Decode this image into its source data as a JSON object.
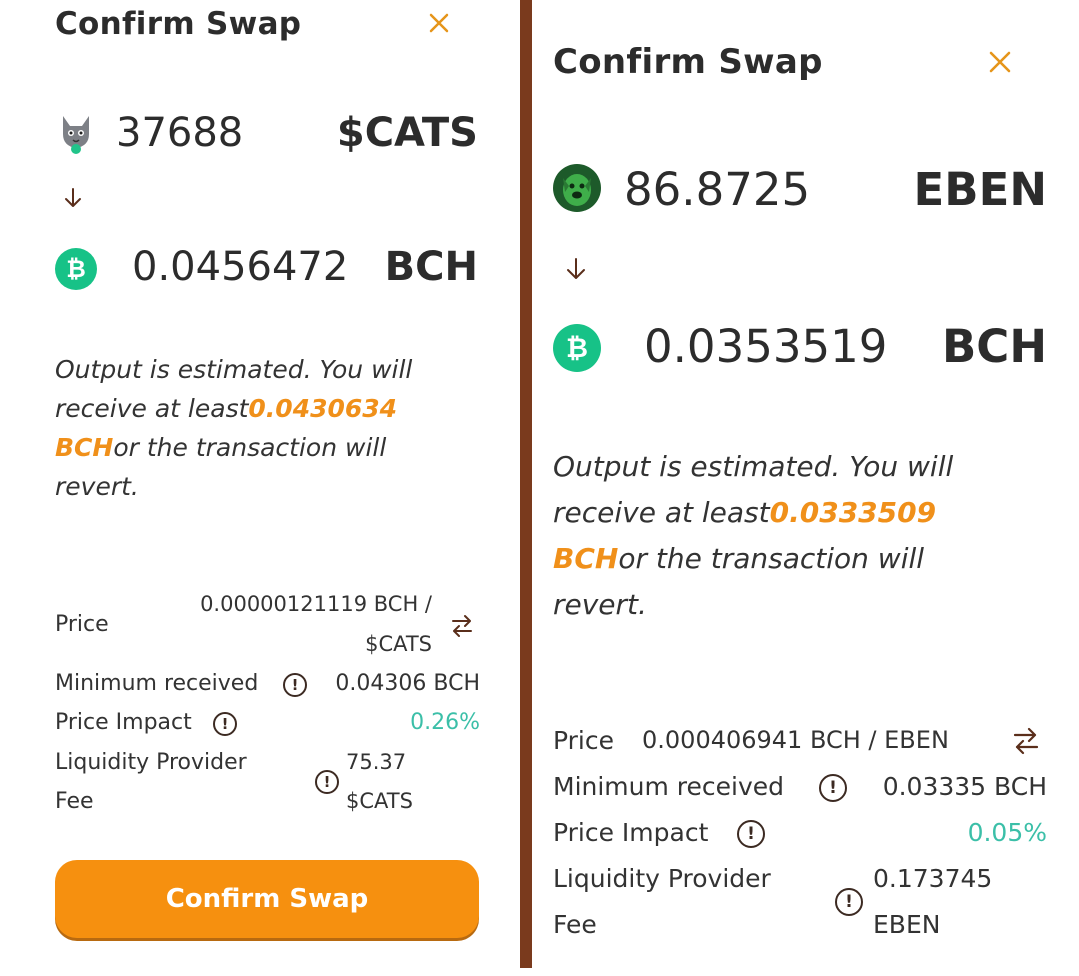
{
  "left": {
    "title": "Confirm Swap",
    "from": {
      "amount": "37688",
      "symbol": "$CATS",
      "icon": "cat-token-icon"
    },
    "to": {
      "amount": "0.0456472",
      "symbol": "BCH",
      "icon": "bch-icon"
    },
    "note": {
      "prefix": "Output is estimated. You will receive at least",
      "amount": "0.0430634",
      "unit": "BCH",
      "suffix": "or the transaction will revert."
    },
    "price_label": "Price",
    "price_value_line1": "0.00000121119 BCH /",
    "price_value_line2": "$CATS",
    "min_received_label": "Minimum received",
    "min_received_value": "0.04306 BCH",
    "impact_label": "Price Impact",
    "impact_value": "0.26%",
    "fee_label_line1": "Liquidity Provider",
    "fee_label_line2": "Fee",
    "fee_value_line1": "75.37",
    "fee_value_line2": "$CATS",
    "confirm_button": "Confirm Swap"
  },
  "right": {
    "title": "Confirm Swap",
    "from": {
      "amount": "86.8725",
      "symbol": "EBEN",
      "icon": "eben-token-icon"
    },
    "to": {
      "amount": "0.0353519",
      "symbol": "BCH",
      "icon": "bch-icon"
    },
    "note": {
      "prefix": "Output is estimated. You will receive at least",
      "amount": "0.0333509",
      "unit": "BCH",
      "suffix": "or the transaction will revert."
    },
    "price_label": "Price",
    "price_value": "0.000406941 BCH / EBEN",
    "min_received_label": "Minimum received",
    "min_received_value": "0.03335 BCH",
    "impact_label": "Price Impact",
    "impact_value": "0.05%",
    "fee_label_line1": "Liquidity Provider",
    "fee_label_line2": "Fee",
    "fee_value_line1": "0.173745",
    "fee_value_line2": "EBEN"
  },
  "colors": {
    "accent": "#f6900f",
    "highlight": "#f0901a",
    "impact": "#3bbfa8",
    "bch": "#17c287",
    "divider": "#7a3a1d"
  }
}
